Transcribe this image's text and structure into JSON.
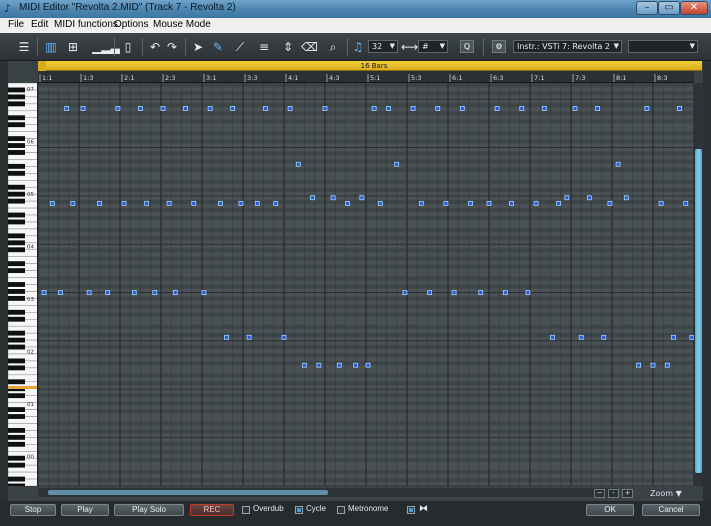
{
  "window": {
    "title": "MIDI Editor \"Revolta 2.MID\"  (Track 7 - Revolta 2)",
    "minimize": "–",
    "maximize": "▭",
    "close": "✕"
  },
  "menu": [
    "File",
    "Edit",
    "MIDI functions",
    "Options",
    "Mouse Mode"
  ],
  "toolbar": {
    "quantize_value": "32",
    "accidental_value": "#",
    "quantize_button": "Q",
    "instrument": "Instr.: VSTi 7: Revolta 2",
    "extra_combo": ""
  },
  "bars_label": "16 Bars",
  "ruler_labels": [
    "1:1",
    "1:3",
    "2:1",
    "2:3",
    "3:1",
    "3:3",
    "4:1",
    "4:3",
    "5:1",
    "5:3",
    "6:1",
    "6:3",
    "7:1",
    "7:3",
    "8:1",
    "8:3"
  ],
  "octave_labels": [
    "07",
    "06",
    "05",
    "04",
    "03",
    "02",
    "01",
    "00"
  ],
  "zoom_label": "Zoom",
  "bottom": {
    "stop": "Stop",
    "play": "Play",
    "play_solo": "Play Solo",
    "rec": "REC",
    "overdub": "Overdub",
    "overdub_checked": false,
    "cycle": "Cycle",
    "cycle_checked": true,
    "metronome": "Metronome",
    "metronome_checked": false,
    "ok": "OK",
    "cancel": "Cancel"
  },
  "colors": {
    "note_fill": "#2a59d8",
    "note_border": "#9fd4ff",
    "bar_strip": "#e0b526",
    "grid_bg": "#454c50",
    "accent": "#3f9be0"
  }
}
